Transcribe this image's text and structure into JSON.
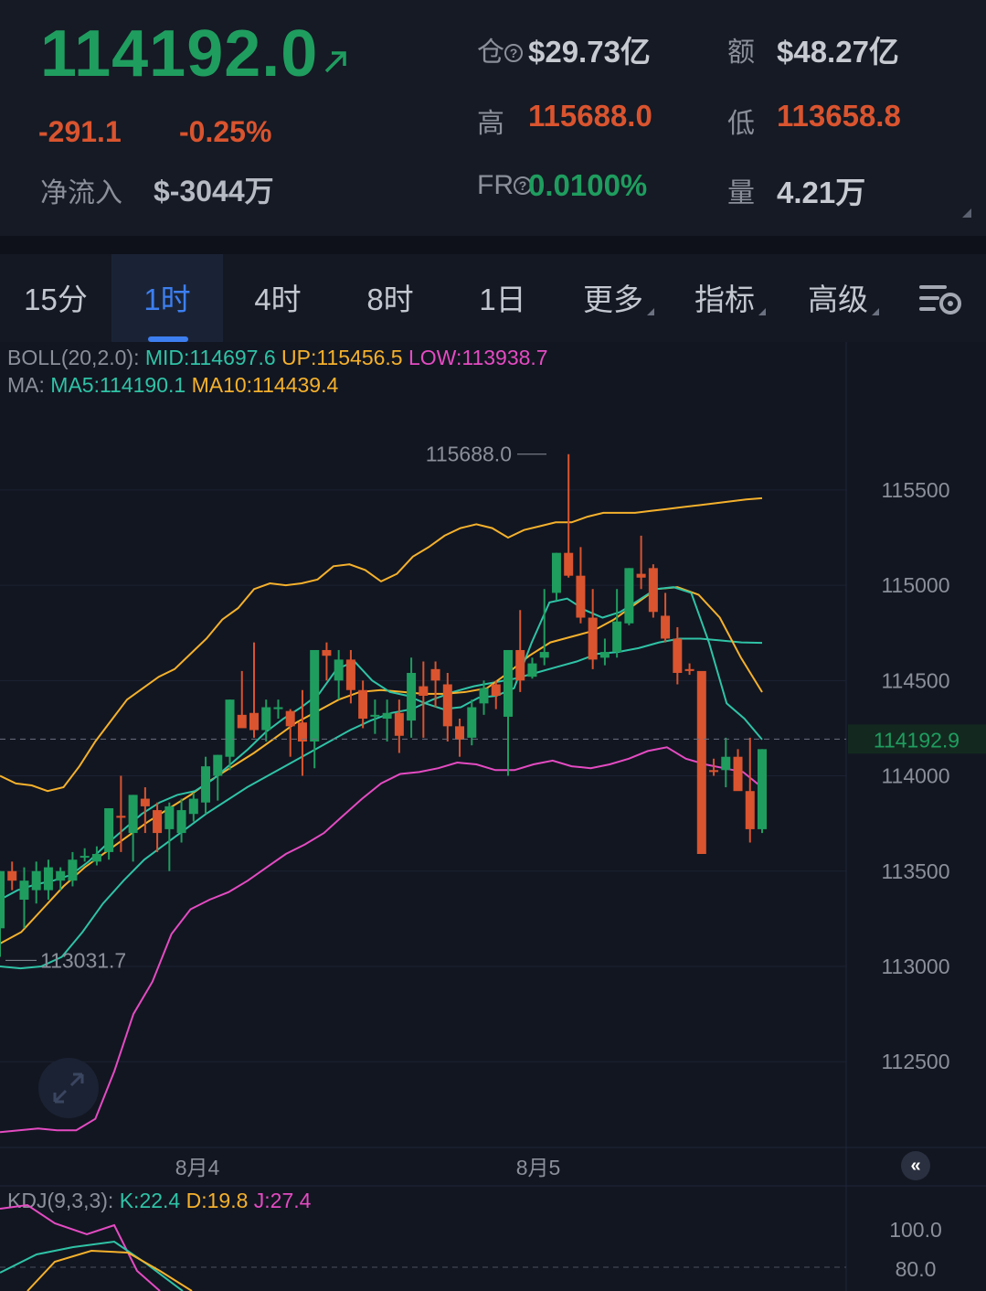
{
  "ticker": {
    "last_price": "114192.0",
    "change": "-291.1",
    "change_pct": "-0.25%",
    "net_inflow_label": "净流入",
    "net_inflow_value": "$-3044万",
    "open_interest_label": "仓",
    "open_interest_value": "$29.73亿",
    "turnover_label": "额",
    "turnover_value": "$48.27亿",
    "high_label": "高",
    "high_value": "115688.0",
    "low_label": "低",
    "low_value": "113658.8",
    "funding_label": "FR",
    "funding_value": "0.0100%",
    "volume_label": "量",
    "volume_value": "4.21万",
    "up_color": "#1f9d5f",
    "down_color": "#d9542f"
  },
  "tabs": [
    {
      "label": "15分",
      "active": false
    },
    {
      "label": "1时",
      "active": true
    },
    {
      "label": "4时",
      "active": false
    },
    {
      "label": "8时",
      "active": false
    },
    {
      "label": "1日",
      "active": false
    },
    {
      "label": "更多",
      "active": false
    },
    {
      "label": "指标",
      "active": false
    },
    {
      "label": "高级",
      "active": false
    }
  ],
  "indicators": {
    "boll_prefix": "BOLL(20,2.0):",
    "boll_mid": "MID:114697.6",
    "boll_up": "UP:115456.5",
    "boll_low": "LOW:113938.7",
    "ma_prefix": "MA:",
    "ma5": "MA5:114190.1",
    "ma10": "MA10:114439.4",
    "kdj_prefix": "KDJ(9,3,3):",
    "kdj_k": "K:22.4",
    "kdj_d": "D:19.8",
    "kdj_j": "J:27.4"
  },
  "chart_data": {
    "type": "candlestick",
    "y_ticks": [
      115500,
      115000,
      114500,
      114000,
      113500,
      113000,
      112500
    ],
    "ylim": [
      112050,
      115960
    ],
    "current_price_label": "114192.9",
    "current_price": 114192.9,
    "max_label": "115688.0",
    "max_value": 115688.0,
    "min_label": "113031.7",
    "min_value": 113031.7,
    "x_labels": [
      "8月4",
      "8月5"
    ],
    "kdj_ticks": [
      "100.0",
      "80.0"
    ],
    "candles": [
      [
        113200,
        113500,
        113050,
        113500
      ],
      [
        113500,
        113450,
        113400,
        113550
      ],
      [
        113350,
        113450,
        113200,
        113520
      ],
      [
        113400,
        113500,
        113330,
        113550
      ],
      [
        113400,
        113520,
        113350,
        113560
      ],
      [
        113450,
        113500,
        113400,
        113520
      ],
      [
        113450,
        113560,
        113420,
        113600
      ],
      [
        113580,
        113580,
        113550,
        113620
      ],
      [
        113550,
        113590,
        113530,
        113630
      ],
      [
        113600,
        113830,
        113560,
        113830
      ],
      [
        113790,
        113780,
        113600,
        114000
      ],
      [
        113700,
        113900,
        113550,
        113900
      ],
      [
        113880,
        113840,
        113700,
        113940
      ],
      [
        113820,
        113700,
        113600,
        113860
      ],
      [
        113720,
        113840,
        113500,
        113860
      ],
      [
        113700,
        113820,
        113650,
        113880
      ],
      [
        113800,
        113880,
        113760,
        113910
      ],
      [
        113860,
        114050,
        113800,
        114100
      ],
      [
        114000,
        114110,
        113870,
        114110
      ],
      [
        114100,
        114400,
        114030,
        114400
      ],
      [
        114320,
        114250,
        114300,
        114550
      ],
      [
        114330,
        114240,
        114200,
        114700
      ],
      [
        114240,
        114360,
        114180,
        114400
      ],
      [
        114350,
        114360,
        114300,
        114400
      ],
      [
        114340,
        114260,
        114100,
        114350
      ],
      [
        114280,
        114180,
        114000,
        114450
      ],
      [
        114180,
        114660,
        114040,
        114660
      ],
      [
        114660,
        114630,
        114500,
        114700
      ],
      [
        114500,
        114610,
        114400,
        114660
      ],
      [
        114610,
        114450,
        114380,
        114660
      ],
      [
        114450,
        114300,
        114250,
        114500
      ],
      [
        114320,
        114320,
        114220,
        114400
      ],
      [
        114300,
        114330,
        114180,
        114400
      ],
      [
        114330,
        114210,
        114120,
        114400
      ],
      [
        114290,
        114540,
        114200,
        114620
      ],
      [
        114470,
        114420,
        114200,
        114600
      ],
      [
        114560,
        114500,
        114360,
        114600
      ],
      [
        114480,
        114260,
        114180,
        114540
      ],
      [
        114260,
        114190,
        114100,
        114300
      ],
      [
        114200,
        114360,
        114160,
        114400
      ],
      [
        114380,
        114460,
        114320,
        114500
      ],
      [
        114480,
        114420,
        114350,
        114500
      ],
      [
        114310,
        114660,
        114000,
        114660
      ],
      [
        114660,
        114500,
        114440,
        114870
      ],
      [
        114520,
        114590,
        114510,
        114620
      ],
      [
        114620,
        114650,
        114580,
        114980
      ],
      [
        114960,
        115170,
        114920,
        115170
      ],
      [
        115170,
        115050,
        115040,
        115688
      ],
      [
        115050,
        114830,
        114800,
        115200
      ],
      [
        114830,
        114610,
        114560,
        114980
      ],
      [
        114620,
        114650,
        114580,
        114720
      ],
      [
        114650,
        114810,
        114620,
        114980
      ],
      [
        114800,
        115090,
        114790,
        115090
      ],
      [
        115060,
        115040,
        114980,
        115260
      ],
      [
        115090,
        114860,
        114830,
        115110
      ],
      [
        114840,
        114720,
        114700,
        114960
      ],
      [
        114720,
        114540,
        114480,
        114780
      ],
      [
        114560,
        114550,
        114530,
        114590
      ],
      [
        114550,
        113590,
        113620,
        114400
      ],
      [
        114030,
        114020,
        114000,
        114090
      ],
      [
        114030,
        114100,
        113940,
        114200
      ],
      [
        114100,
        113920,
        113930,
        114140
      ],
      [
        113920,
        113720,
        113650,
        114200
      ],
      [
        113720,
        114140,
        113700,
        114140
      ]
    ],
    "boll_up": [
      114000,
      113960,
      113950,
      113920,
      113940,
      114050,
      114180,
      114290,
      114400,
      114460,
      114520,
      114560,
      114640,
      114720,
      114820,
      114880,
      114980,
      115010,
      115000,
      115010,
      115030,
      115100,
      115110,
      115080,
      115020,
      115060,
      115150,
      115200,
      115260,
      115300,
      115320,
      115300,
      115250,
      115290,
      115310,
      115330,
      115330,
      115360,
      115380,
      115380,
      115380,
      115390,
      115400,
      115410,
      115420,
      115430,
      115440,
      115450,
      115456.5
    ],
    "boll_mid": [
      113000,
      112990,
      113000,
      113050,
      113180,
      113330,
      113450,
      113560,
      113640,
      113720,
      113800,
      113870,
      113940,
      114000,
      114060,
      114120,
      114180,
      114240,
      114290,
      114330,
      114350,
      114400,
      114440,
      114470,
      114490,
      114510,
      114540,
      114570,
      114600,
      114640,
      114650,
      114670,
      114700,
      114720,
      114720,
      114710,
      114700,
      114697.6
    ],
    "boll_low": [
      112130,
      112140,
      112150,
      112140,
      112140,
      112200,
      112450,
      112750,
      112920,
      113170,
      113300,
      113350,
      113390,
      113450,
      113520,
      113590,
      113640,
      113700,
      113790,
      113880,
      113960,
      114010,
      114020,
      114040,
      114070,
      114060,
      114030,
      114030,
      114060,
      114080,
      114050,
      114040,
      114060,
      114090,
      114130,
      114150,
      114090,
      114060,
      114040,
      114020,
      113938.7
    ],
    "ma5": [
      113350,
      113400,
      113430,
      113450,
      113480,
      113550,
      113640,
      113720,
      113800,
      113860,
      113900,
      113920,
      113980,
      114060,
      114140,
      114230,
      114300,
      114360,
      114430,
      114560,
      114600,
      114500,
      114440,
      114420,
      114380,
      114350,
      114360,
      114410,
      114420,
      114460,
      114700,
      114910,
      114930,
      114870,
      114830,
      114860,
      114920,
      114980,
      114990,
      114960,
      114700,
      114380,
      114300,
      114190.1
    ],
    "ma10": [
      113120,
      113180,
      113300,
      113420,
      113520,
      113600,
      113680,
      113760,
      113830,
      113900,
      113980,
      114050,
      114120,
      114200,
      114280,
      114340,
      114400,
      114440,
      114450,
      114440,
      114430,
      114430,
      114440,
      114460,
      114540,
      114630,
      114700,
      114730,
      114760,
      114820,
      114900,
      114980,
      114990,
      114950,
      114830,
      114620,
      114439.4
    ]
  }
}
